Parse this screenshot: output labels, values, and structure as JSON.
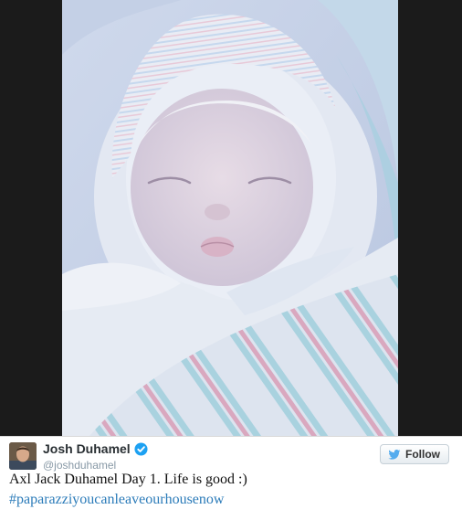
{
  "tweet": {
    "author": {
      "display_name": "Josh Duhamel",
      "handle": "@joshduhamel",
      "verified": true,
      "avatar_icon": "profile-photo"
    },
    "follow_label": "Follow",
    "text": "Axl Jack Duhamel Day 1. Life is good :)",
    "hashtag": "#paparazziyoucanleaveourhousenow",
    "photo_subject": "newborn-baby-in-striped-hospital-blanket"
  },
  "colors": {
    "frame": "#1b1b1b",
    "link": "#2b7bb9",
    "verified": "#1da1f2",
    "twitter_blue": "#55acee"
  }
}
